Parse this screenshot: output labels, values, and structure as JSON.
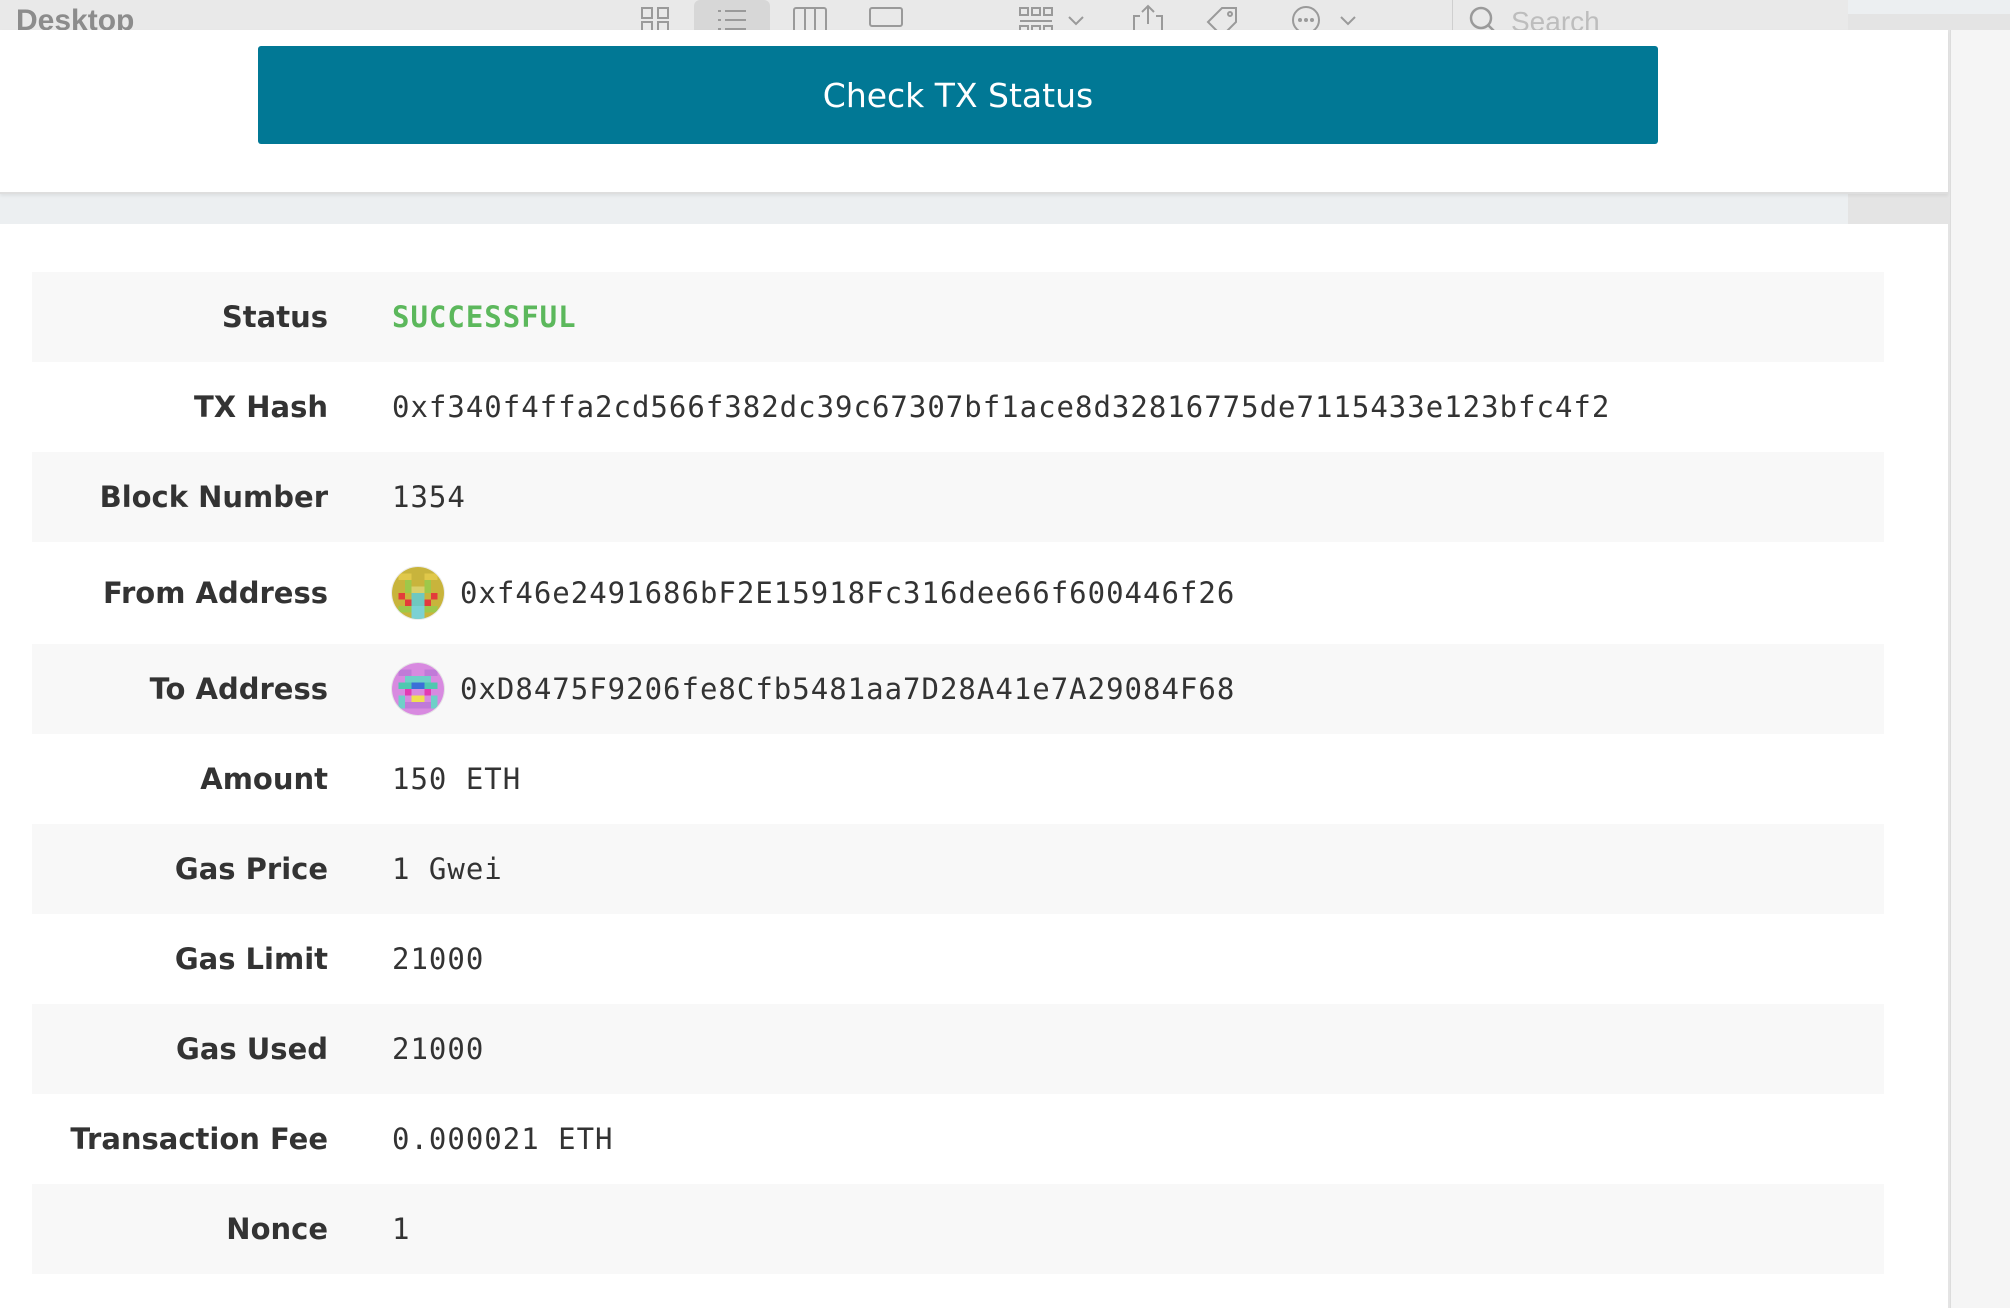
{
  "finder": {
    "title": "Desktop",
    "search_placeholder": "Search"
  },
  "actions": {
    "check_status_label": "Check TX Status"
  },
  "transaction": {
    "rows": [
      {
        "label": "Status",
        "value": "SUCCESSFUL"
      },
      {
        "label": "TX Hash",
        "value": "0xf340f4ffa2cd566f382dc39c67307bf1ace8d32816775de7115433e123bfc4f2"
      },
      {
        "label": "Block Number",
        "value": "1354"
      },
      {
        "label": "From Address",
        "value": "0xf46e2491686bF2E15918Fc316dee66f600446f26"
      },
      {
        "label": "To Address",
        "value": "0xD8475F9206fe8Cfb5481aa7D28A41e7A29084F68"
      },
      {
        "label": "Amount",
        "value": "150 ETH"
      },
      {
        "label": "Gas Price",
        "value": "1 Gwei"
      },
      {
        "label": "Gas Limit",
        "value": "21000"
      },
      {
        "label": "Gas Used",
        "value": "21000"
      },
      {
        "label": "Transaction Fee",
        "value": "0.000021 ETH"
      },
      {
        "label": "Nonce",
        "value": "1"
      }
    ]
  },
  "colors": {
    "primary_button": "#017895",
    "success": "#5cb85c"
  }
}
